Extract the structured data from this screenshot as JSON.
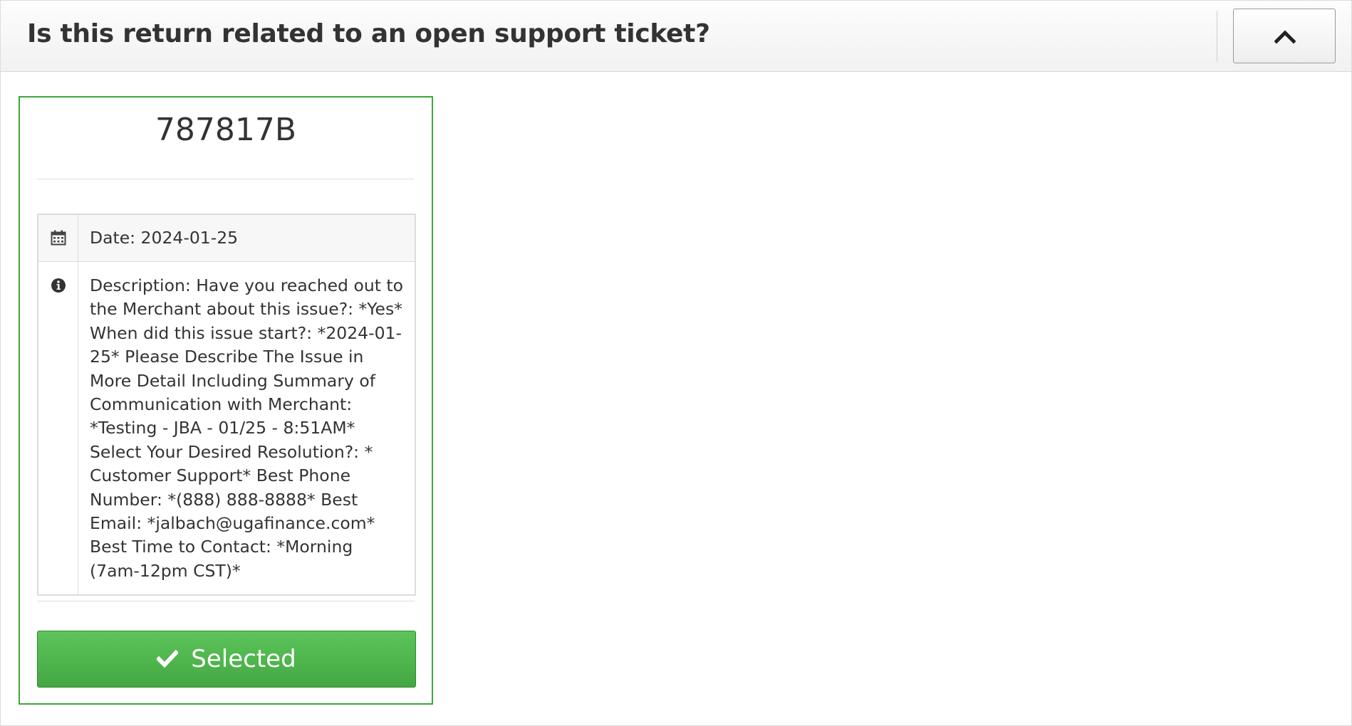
{
  "header": {
    "title": "Is this return related to an open support ticket?",
    "collapse_icon": "chevron-up-icon"
  },
  "ticket": {
    "id": "787817B",
    "date_text": "Date: 2024-01-25",
    "date_icon": "calendar-icon",
    "description_icon": "info-circle-icon",
    "description_text": "Description: Have you reached out to the Merchant about this issue?: *Yes* When did this issue start?: *2024-01-25* Please Describe The Issue in More Detail Including Summary of Communication with Merchant: *Testing - JBA - 01/25 - 8:51AM* Select Your Desired Resolution?: * Customer Support* Best Phone Number: *(888) 888-8888* Best Email: *jalbach@ugafinance.com* Best Time to Contact: *Morning (7am-12pm CST)*",
    "select_button_label": "Selected",
    "select_icon": "check-icon"
  },
  "colors": {
    "accent_green": "#44a842",
    "card_border": "#3fa63a"
  }
}
